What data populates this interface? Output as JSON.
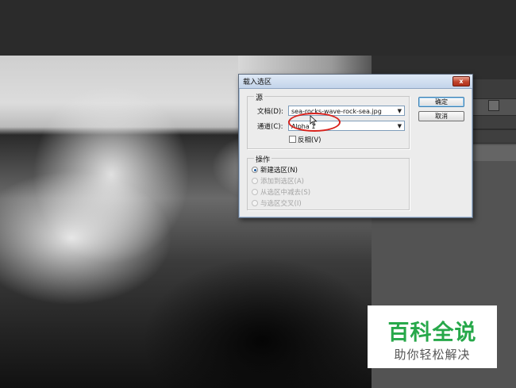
{
  "dialog": {
    "title": "载入选区",
    "close_label": "x",
    "source_group": "源",
    "document_label": "文档(D):",
    "document_value": "sea-rocks-wave-rock-sea.jpg",
    "channel_label": "通道(C):",
    "channel_value": "Alpha 1",
    "invert_label": "反相(V)",
    "operation_group": "操作",
    "operations": [
      {
        "label": "新建选区(N)",
        "selected": true,
        "enabled": true
      },
      {
        "label": "添加到选区(A)",
        "selected": false,
        "enabled": false
      },
      {
        "label": "从选区中减去(S)",
        "selected": false,
        "enabled": false
      },
      {
        "label": "与选区交叉(I)",
        "selected": false,
        "enabled": false
      }
    ],
    "ok_label": "确定",
    "cancel_label": "取消"
  },
  "watermark": {
    "title": "百科全说",
    "subtitle": "助你轻松解决"
  },
  "colors": {
    "highlight": "#d9221c",
    "watermark_green": "#27a84a"
  }
}
